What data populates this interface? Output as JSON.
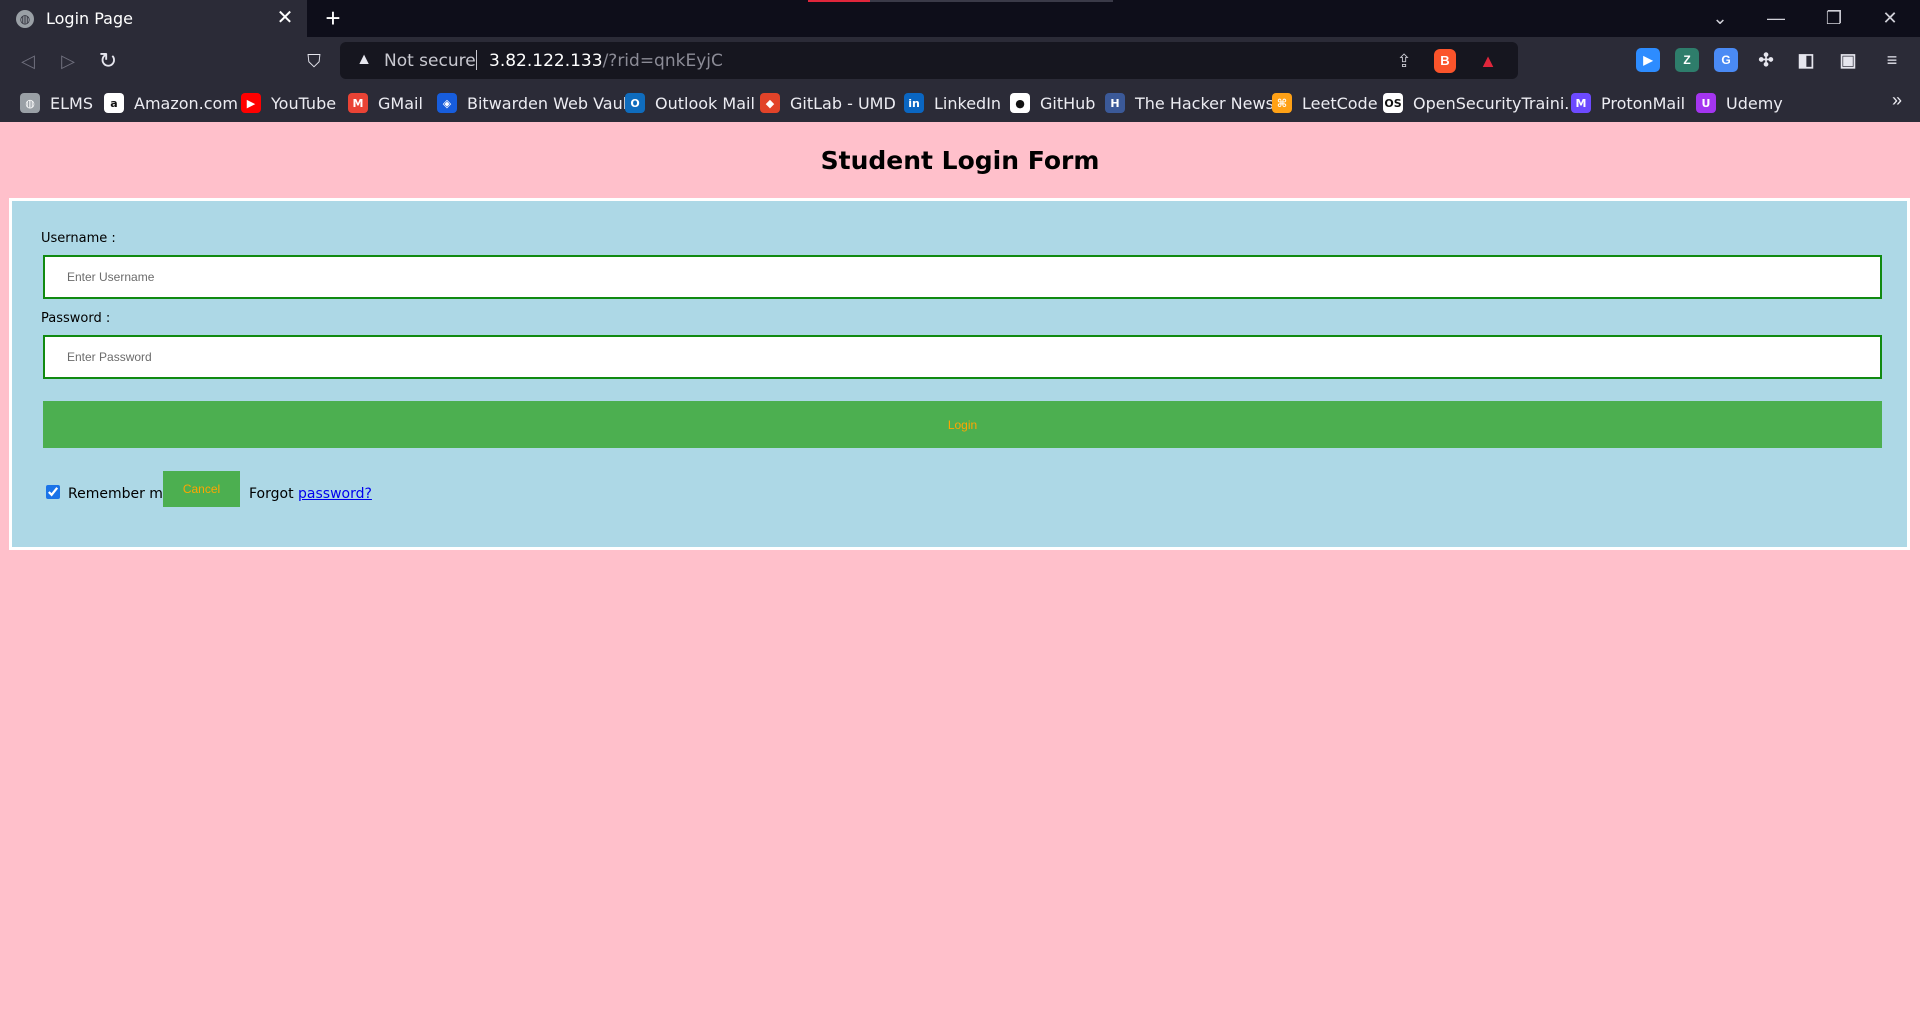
{
  "browser": {
    "tab_title": "Login Page",
    "tab_close": "✕",
    "new_tab": "+",
    "url_warning": "Not secure",
    "url_host": "3.82.122.133",
    "url_path": "/?rid=qnkEyjC",
    "window_controls": {
      "minimize": "—",
      "restore": "❐",
      "close": "✕",
      "tab_search": "⌄"
    }
  },
  "bookmarks": [
    {
      "label": "ELMS",
      "icon": "globe-icon",
      "color": "#9aa0a6",
      "glyph": "◍"
    },
    {
      "label": "Amazon.com",
      "icon": "amazon-icon",
      "color": "#ffffff",
      "glyph": "a"
    },
    {
      "label": "YouTube",
      "icon": "youtube-icon",
      "color": "#ff0000",
      "glyph": "▶"
    },
    {
      "label": "GMail",
      "icon": "gmail-icon",
      "color": "#ea4335",
      "glyph": "M"
    },
    {
      "label": "Bitwarden Web Vault",
      "icon": "bitwarden-icon",
      "color": "#175ddc",
      "glyph": "◈"
    },
    {
      "label": "Outlook Mail",
      "icon": "outlook-icon",
      "color": "#0f6cbd",
      "glyph": "O"
    },
    {
      "label": "GitLab - UMD",
      "icon": "gitlab-icon",
      "color": "#e24329",
      "glyph": "◆"
    },
    {
      "label": "LinkedIn",
      "icon": "linkedin-icon",
      "color": "#0a66c2",
      "glyph": "in"
    },
    {
      "label": "GitHub",
      "icon": "github-icon",
      "color": "#ffffff",
      "glyph": "●"
    },
    {
      "label": "The Hacker News",
      "icon": "hackernews-icon",
      "color": "#3b5998",
      "glyph": "H"
    },
    {
      "label": "LeetCode",
      "icon": "leetcode-icon",
      "color": "#ffa116",
      "glyph": "⌘"
    },
    {
      "label": "OpenSecurityTraini...",
      "icon": "ost2-icon",
      "color": "#ffffff",
      "glyph": "OS"
    },
    {
      "label": "ProtonMail",
      "icon": "protonmail-icon",
      "color": "#6d4aff",
      "glyph": "M"
    },
    {
      "label": "Udemy",
      "icon": "udemy-icon",
      "color": "#a435f0",
      "glyph": "U"
    }
  ],
  "page": {
    "title": "Student Login Form",
    "username_label": "Username :",
    "username_placeholder": "Enter Username",
    "password_label": "Password :",
    "password_placeholder": "Enter Password",
    "login_label": "Login",
    "remember_label": "Remember me",
    "cancel_label": "Cancel",
    "forgot_prefix": "Forgot",
    "forgot_link": "password?"
  },
  "colors": {
    "page_bg": "#ffc0cb",
    "form_bg": "#add8e6",
    "button_bg": "#4caf50",
    "button_text": "#ffa500",
    "field_border": "#118a11"
  }
}
